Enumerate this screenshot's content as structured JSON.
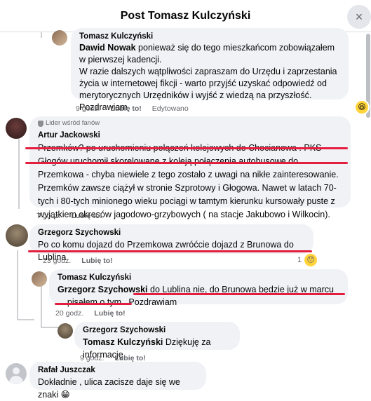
{
  "header": {
    "title": "Post Tomasz Kulczyński",
    "close_icon": "×"
  },
  "comments": [
    {
      "author": "Tomasz Kulczyński",
      "mention": "Dawid Nowak",
      "text": " ponieważ się do tego mieszkańcom zobowiązałem w pierwszej kadencji.",
      "text2": "W razie dalszych wątpliwości zapraszam do Urzędu i zaprzestania życia w internetowej fikcji - warto przyjść uzyskać odpowiedź od merytorycznych Urzędników i wyjść z wiedzą na przyszłość. Pozdrawiam",
      "time": "9 godz.",
      "like": "Lubię to!",
      "edited": "Edytowano",
      "reaction": "😆"
    },
    {
      "badge": "Lider wśród fanów",
      "author": "Artur Jackowski",
      "text": "Przemków? po uruchomieniu połączeń kolejowych do Chocianowa . PKS Głogów uruchomił skorelowane z koleją połączenia autobusowe do Przemkowa - chyba niewiele z tego zostało z uwagi na nikłe zainteresowanie. Przemków zawsze ciążył w stronie Szprotowy i Głogowa. Nawet w latach 70-tych i 80-tych minionego wieku pociągi w tamtym kierunku kursowały puste z wyjątkiem okresów jagodowo-grzybowych ( na stacje Jakubowo i Wilkocin).",
      "time": "7 godz.",
      "like": "Lubię to!"
    },
    {
      "author": "Grzegorz Szychowski",
      "text": "Po co komu dojazd do Przemkowa zwróćcie dojazd z Brunowa do Lublina",
      "time": "23 godz.",
      "like": "Lubię to!",
      "reaction_count": "1",
      "reaction": "😯"
    },
    {
      "author": "Tomasz Kulczyński",
      "mention": "Grzegorz Szychowski",
      "text": " do Lublina nie, do Brunowa będzie już w marcu ... pisałem o tym . Pozdrawiam",
      "time": "20 godz.",
      "like": "Lubię to!"
    },
    {
      "author": "Grzegorz Szychowski",
      "mention": "Tomasz Kulczyński",
      "text": " Dziękuję za informację",
      "time": "9 godz.",
      "like": "Lubię to!"
    },
    {
      "author": "Rafał Juszczak",
      "text": "Dokładnie , ulica zacisze daje się we znaki",
      "emoji": "😁"
    }
  ],
  "icons": {
    "close": "close-icon",
    "badge": "shield-icon"
  },
  "colors": {
    "bubble": "#f0f2f5",
    "annotation": "#e41e3f",
    "meta": "#65676b"
  }
}
